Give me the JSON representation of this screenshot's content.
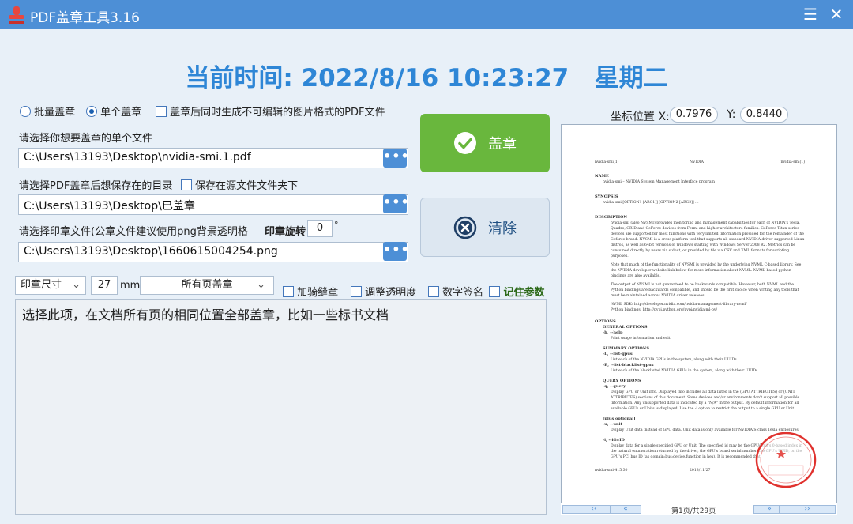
{
  "window": {
    "title": "PDF盖章工具3.16",
    "menu_icon": "hamburger-menu-icon",
    "close_icon": "close-icon"
  },
  "clock": {
    "label": "当前时间:",
    "datetime": "2022/8/16 10:23:27",
    "weekday": "星期二"
  },
  "options": {
    "batch_label": "批量盖章",
    "single_label": "单个盖章",
    "mode_selected": "single",
    "image_pdf_label": "盖章后同时生成不可编辑的图片格式的PDF文件",
    "image_pdf_checked": false
  },
  "file_select": {
    "label": "请选择你想要盖章的单个文件",
    "value": "C:\\Users\\13193\\Desktop\\nvidia-smi.1.pdf",
    "browse": "•••"
  },
  "save_dir": {
    "label": "请选择PDF盖章后想保存在的目录",
    "same_folder_label": "保存在源文件文件夹下",
    "same_folder_checked": false,
    "value": "C:\\Users\\13193\\Desktop\\已盖章",
    "browse": "•••"
  },
  "seal_file": {
    "label": "请选择印章文件(公章文件建议使用png背景透明格",
    "rotate_label": "印章旋转",
    "rotate_value": "0",
    "rotate_unit": "°",
    "value": "C:\\Users\\13193\\Desktop\\1660615004254.png",
    "browse": "•••"
  },
  "buttons": {
    "stamp_label": "盖章",
    "clear_label": "清除"
  },
  "seal_options": {
    "size_label": "印章尺寸",
    "size_value": "27",
    "size_unit": "mm",
    "pages_value": "所有页盖章",
    "seam_label": "加骑缝章",
    "opacity_label": "调整透明度",
    "digital_sign_label": "数字签名",
    "remember_label": "记住参数"
  },
  "description": "选择此项，在文档所有页的相同位置全部盖章，比如一些标书文档",
  "coords": {
    "label": "坐标位置",
    "x_label": "X:",
    "x_value": "0.7976",
    "y_label": "Y:",
    "y_value": "0.8440"
  },
  "preview": {
    "header_left": "nvidia-smi(1)",
    "header_center": "NVIDIA",
    "header_right": "nvidia-smi(1)",
    "name_heading": "NAME",
    "name_text": "nvidia-smi – NVIDIA System Management Interface program",
    "synopsis_heading": "SYNOPSIS",
    "synopsis_text": "nvidia-smi [OPTION1 [ARG1]] [OPTION2 [ARG2]] ...",
    "description_heading": "DESCRIPTION",
    "desc_p1": "nvidia-smi (also NVSMI) provides monitoring and management capabilities for each of NVIDIA's Tesla, Quadro, GRID and GeForce devices from Fermi and higher architecture families. GeForce Titan series devices are supported for most functions with very limited information provided for the remainder of the Geforce brand. NVSMI is a cross platform tool that supports all standard NVIDIA driver-supported Linux distros, as well as 64bit versions of Windows starting with Windows Server 2008 R2. Metrics can be consumed directly by users via stdout, or provided by file via CSV and XML formats for scripting purposes.",
    "desc_p2": "Note that much of the functionality of NVSMI is provided by the underlying NVML C-based library. See the NVIDIA developer website link below for more information about NVML. NVML-based python bindings are also available.",
    "desc_p3": "The output of NVSMI is not guaranteed to be backwards compatible. However, both NVML and the Python bindings are backwards compatible, and should be the first choice when writing any tools that must be maintained across NVIDIA driver releases.",
    "nvml_sdk": "NVML SDK: http://developer.nvidia.com/nvidia-management-library-nvml/",
    "python_bindings": "Python bindings: http://pypi.python.org/pypi/nvidia-ml-py/",
    "options_heading": "OPTIONS",
    "general_options": "GENERAL OPTIONS",
    "opt_help": "-h, --help",
    "opt_help_desc": "Print usage information and exit.",
    "summary_options": "SUMMARY OPTIONS",
    "opt_list_gpus": "-L, --list-gpus",
    "opt_list_gpus_desc": "List each of the NVIDIA GPUs in the system, along with their UUIDs.",
    "opt_blacklist": "-B, --list-blacklist-gpus",
    "opt_blacklist_desc": "List each of the blacklisted NVIDIA GPUs in the system, along with their UUIDs.",
    "query_options": "QUERY OPTIONS",
    "opt_query": "-q, --query",
    "opt_query_desc": "Display GPU or Unit info. Displayed info includes all data listed in the (GPU ATTRIBUTES) or (UNIT ATTRIBUTES) sections of this document. Some devices and/or environments don't support all possible information. Any unsupported data is indicated by a \"N/A\" in the output. By default information for all available GPUs or Units is displayed. Use the -i option to restrict the output to a single GPU or Unit.",
    "plus_optional": "[plus optional]",
    "opt_unit": "-u, --unit",
    "opt_unit_desc": "Display Unit data instead of GPU data. Unit data is only available for NVIDIA S-class Tesla enclosures.",
    "opt_id": "-i, --id=ID",
    "opt_id_desc": "Display data for a single specified GPU or Unit. The specified id may be the GPU/Unit's 0-based index in the natural enumeration returned by the driver, the GPU's board serial number, the GPU's UUID, or the GPU's PCI bus ID (as domain:bus:device.function in hex). It is recommended that",
    "footer_left": "nvidia-smi 415.30",
    "footer_right": "2018/11/27",
    "pager_text": "第1页/共29页",
    "prev_first": "‹‹",
    "prev": "«",
    "next": "»",
    "next_last": "››"
  },
  "colors": {
    "titlebar": "#4d8fd6",
    "clock": "#2e86d6",
    "stamp_button": "#69b73d",
    "seal_red": "#e0322e"
  }
}
